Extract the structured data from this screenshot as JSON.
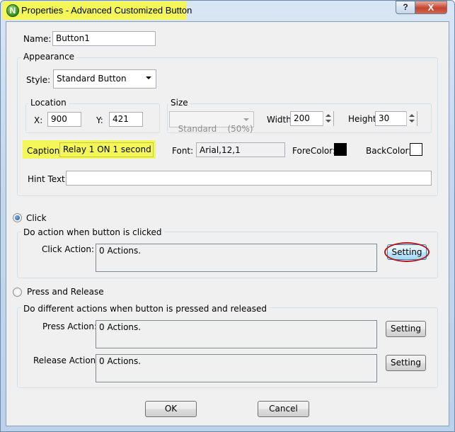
{
  "window": {
    "app_icon_letter": "N",
    "title": "Properties - Advanced Customized Button",
    "help_glyph": "?",
    "close_glyph": "X"
  },
  "general": {
    "name_label": "Name:",
    "name_value": "Button1"
  },
  "appearance": {
    "group_label": "Appearance",
    "style_label": "Style:",
    "style_value": "Standard Button",
    "location": {
      "group_label": "Location",
      "x_label": "X:",
      "x_value": "900",
      "y_label": "Y:",
      "y_value": "421"
    },
    "size": {
      "group_label": "Size",
      "preset_value": "Standard    (50%)",
      "width_label": "Width:",
      "width_value": "200",
      "height_label": "Height:",
      "height_value": "30"
    },
    "caption_label": "Caption:",
    "caption_value": "Relay 1 ON 1 second",
    "font_label": "Font:",
    "font_value": "Arial,12,1",
    "forecolor_label": "ForeColor:",
    "forecolor": "#000000",
    "backcolor_label": "BackColor:",
    "backcolor": "#ffffff",
    "hint_label": "Hint Text:",
    "hint_value": ""
  },
  "click_mode": {
    "radio_label": "Click",
    "selected": true,
    "group_label": "Do action when button is clicked",
    "action_label": "Click Action:",
    "action_value": "0 Actions.",
    "setting_label": "Setting"
  },
  "press_release_mode": {
    "radio_label": "Press and Release",
    "selected": false,
    "group_label": "Do different actions when button is pressed and released",
    "press_label": "Press Action:",
    "press_value": "0 Actions.",
    "press_setting_label": "Setting",
    "release_label": "Release Action:",
    "release_value": "0 Actions.",
    "release_setting_label": "Setting"
  },
  "footer": {
    "ok_label": "OK",
    "cancel_label": "Cancel"
  },
  "highlight_color": "#f4f75a",
  "annotation_ring_color": "#b5161a"
}
